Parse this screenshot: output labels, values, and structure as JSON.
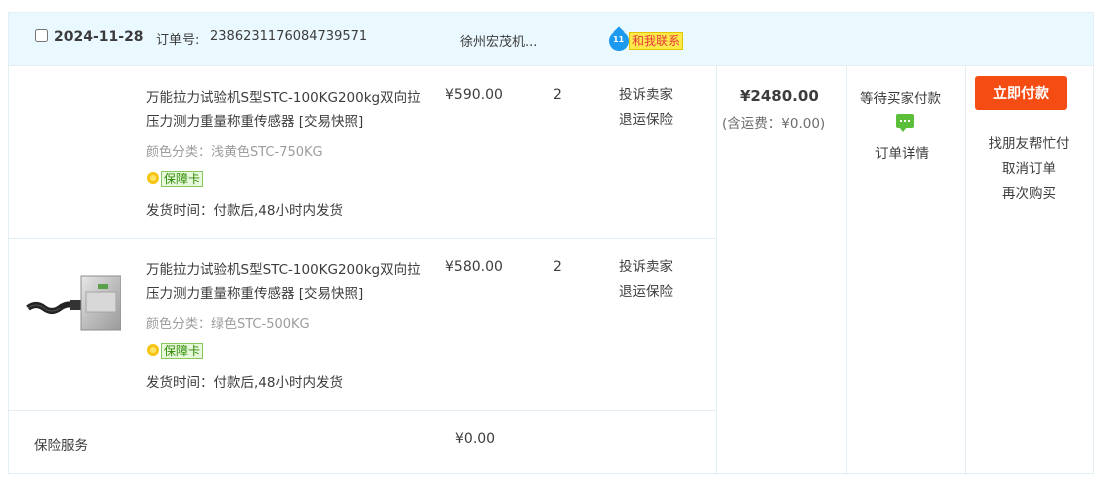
{
  "header": {
    "date": "2024-11-28",
    "order_label": "订单号:",
    "order_no": "2386231176084739571",
    "shop": "徐州宏茂机...",
    "contact": "和我联系",
    "ww_badge": "11"
  },
  "items": [
    {
      "title": "万能拉力试验机S型STC-100KG200kg双向拉压力测力重量称重传感器 [交易快照]",
      "sku": "颜色分类：浅黄色STC-750KG",
      "badge": "保障卡",
      "ship": "发货时间：付款后,48小时内发货",
      "price": "¥590.00",
      "qty": "2",
      "links": [
        "投诉卖家",
        "退运保险"
      ]
    },
    {
      "title": "万能拉力试验机S型STC-100KG200kg双向拉压力测力重量称重传感器 [交易快照]",
      "sku": "颜色分类：绿色STC-500KG",
      "badge": "保障卡",
      "ship": "发货时间：付款后,48小时内发货",
      "price": "¥580.00",
      "qty": "2",
      "links": [
        "投诉卖家",
        "退运保险"
      ]
    }
  ],
  "insurance": {
    "label": "保险服务",
    "price": "¥0.00"
  },
  "summary": {
    "total": "¥2480.00",
    "ship_fee": "(含运费：¥0.00)",
    "status": "等待买家付款",
    "detail": "订单详情"
  },
  "ops": {
    "pay": "立即付款",
    "friend_pay": "找朋友帮忙付",
    "cancel": "取消订单",
    "rebuy": "再次购买"
  },
  "colors": {
    "header_bg": "#eaf8ff",
    "pay_button": "#f44c13",
    "border": "#e3eef5"
  }
}
